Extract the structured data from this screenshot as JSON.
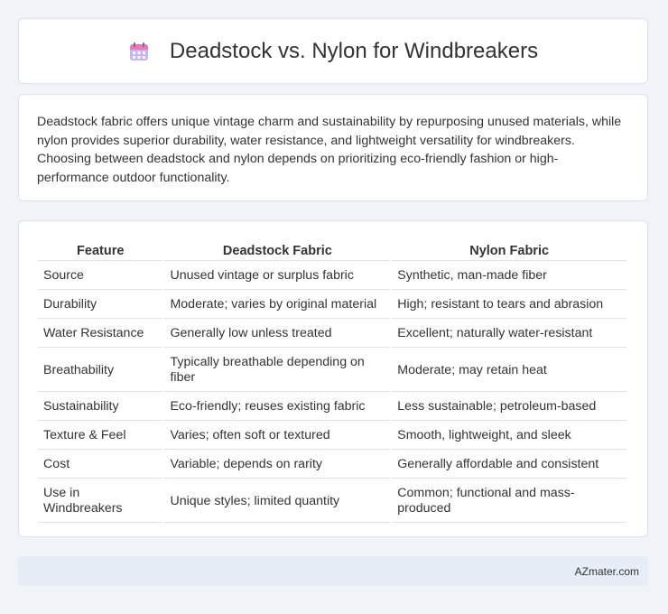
{
  "header": {
    "title": "Deadstock vs. Nylon for Windbreakers",
    "icon": "calendar-icon"
  },
  "intro": {
    "text": "Deadstock fabric offers unique vintage charm and sustainability by repurposing unused materials, while nylon provides superior durability, water resistance, and lightweight versatility for windbreakers. Choosing between deadstock and nylon depends on prioritizing eco-friendly fashion or high-performance outdoor functionality."
  },
  "table": {
    "headers": [
      "Feature",
      "Deadstock Fabric",
      "Nylon Fabric"
    ],
    "rows": [
      [
        "Source",
        "Unused vintage or surplus fabric",
        "Synthetic, man-made fiber"
      ],
      [
        "Durability",
        "Moderate; varies by original material",
        "High; resistant to tears and abrasion"
      ],
      [
        "Water Resistance",
        "Generally low unless treated",
        "Excellent; naturally water-resistant"
      ],
      [
        "Breathability",
        "Typically breathable depending on fiber",
        "Moderate; may retain heat"
      ],
      [
        "Sustainability",
        "Eco-friendly; reuses existing fabric",
        "Less sustainable; petroleum-based"
      ],
      [
        "Texture & Feel",
        "Varies; often soft or textured",
        "Smooth, lightweight, and sleek"
      ],
      [
        "Cost",
        "Variable; depends on rarity",
        "Generally affordable and consistent"
      ],
      [
        "Use in Windbreakers",
        "Unique styles; limited quantity",
        "Common; functional and mass-produced"
      ]
    ]
  },
  "footer": {
    "text": "AZmater.com"
  },
  "colors": {
    "background": "#f0f4f9",
    "card": "#ffffff",
    "border": "#dde3ec",
    "footer": "#e6edf7",
    "icon_accent": "#a78bfa"
  }
}
